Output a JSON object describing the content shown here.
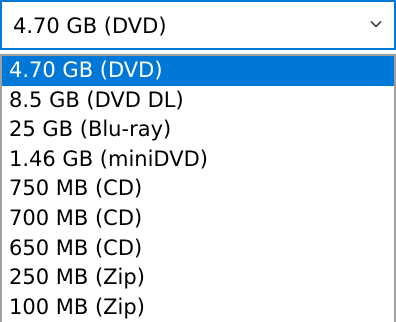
{
  "combo": {
    "value": "4.70 GB (DVD)",
    "chevron_icon": "chevron-down-icon"
  },
  "options": [
    {
      "label": "4.70 GB (DVD)",
      "selected": true
    },
    {
      "label": "8.5 GB (DVD DL)",
      "selected": false
    },
    {
      "label": "25 GB (Blu-ray)",
      "selected": false
    },
    {
      "label": "1.46 GB (miniDVD)",
      "selected": false
    },
    {
      "label": "750 MB (CD)",
      "selected": false
    },
    {
      "label": "700 MB (CD)",
      "selected": false
    },
    {
      "label": "650 MB (CD)",
      "selected": false
    },
    {
      "label": "250 MB (Zip)",
      "selected": false
    },
    {
      "label": "100 MB (Zip)",
      "selected": false
    }
  ],
  "colors": {
    "accent": "#0078d7",
    "list_border": "#a0a0a0",
    "chevron": "#444444"
  }
}
